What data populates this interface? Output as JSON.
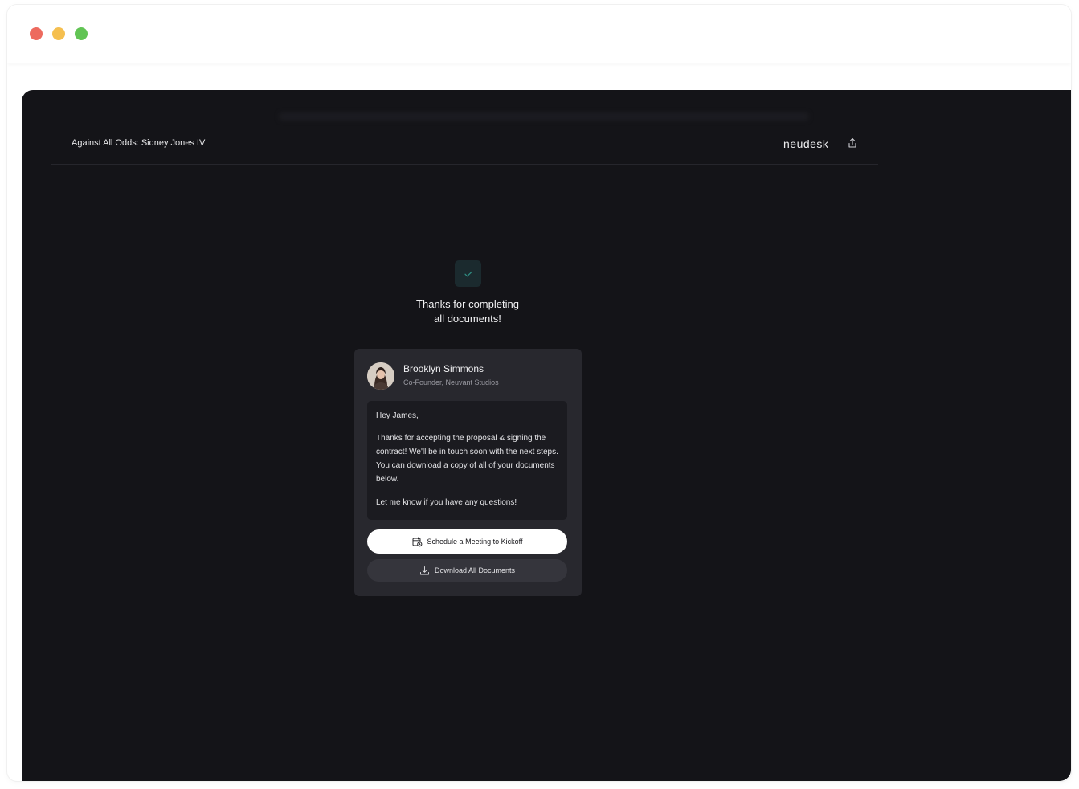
{
  "header": {
    "doc_title": "Against All Odds: Sidney Jones IV",
    "brand": "neudesk"
  },
  "completion": {
    "message_line1": "Thanks for completing",
    "message_line2": "all documents!"
  },
  "card": {
    "name": "Brooklyn Simmons",
    "role": "Co-Founder, Neuvant Studios",
    "greeting": "Hey James,",
    "body": "Thanks for accepting the proposal & signing the contract! We'll be in touch soon with the next steps. You can download a copy of all of your documents below.",
    "closing": "Let me know if you have any questions!",
    "schedule_label": "Schedule a Meeting to Kickoff",
    "download_label": "Download All Documents"
  },
  "colors": {
    "app_bg": "#141418",
    "card_bg": "#28282e",
    "check_accent": "#2f8f84"
  }
}
